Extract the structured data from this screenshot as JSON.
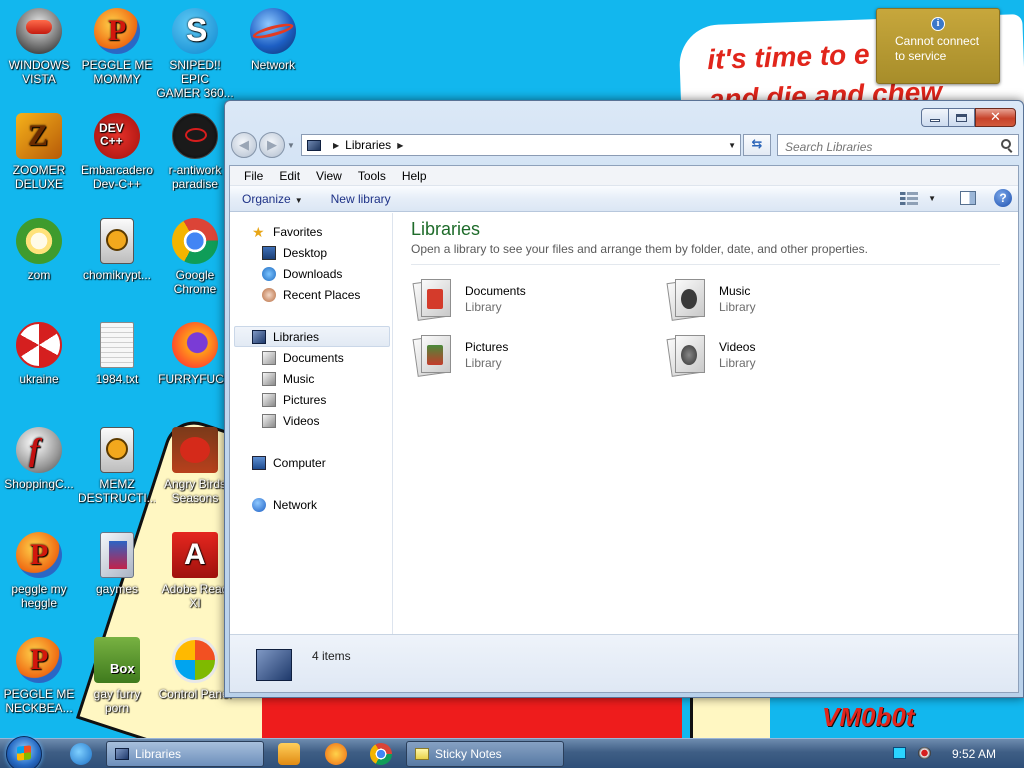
{
  "wallpaper": {
    "caption_line1": "it's time to e",
    "caption_line2": "and die and chew",
    "signature": "VM0b0t"
  },
  "desktop_icons": [
    {
      "label": "WINDOWS\nVISTA",
      "icon": "windows-vista-icon"
    },
    {
      "label": "PEGGLE ME\nMOMMY",
      "icon": "peggle-icon"
    },
    {
      "label": "SNIPED!! EPIC\nGAMER 360...",
      "icon": "skype-icon"
    },
    {
      "label": "Network",
      "icon": "network-globe-icon"
    },
    {
      "label": "ZOOMER\nDELUXE",
      "icon": "zuma-icon"
    },
    {
      "label": "Embarcadero\nDev-C++",
      "icon": "devcpp-icon"
    },
    {
      "label": "r-antiwork\nparadise",
      "icon": "r-antiwork-icon"
    },
    {
      "label": "zom",
      "icon": "plant-icon"
    },
    {
      "label": "chomikrypt...",
      "icon": "clock-doc-icon"
    },
    {
      "label": "Google\nChrome",
      "icon": "chrome-icon"
    },
    {
      "label": "ukraine",
      "icon": "radiation-icon"
    },
    {
      "label": "1984.txt",
      "icon": "text-file-icon"
    },
    {
      "label": "FURRYFUCK",
      "icon": "firefox-icon"
    },
    {
      "label": "ShoppingC...",
      "icon": "flash-icon"
    },
    {
      "label": "MEMZ\nDESTRUCTI...",
      "icon": "clock-doc-icon"
    },
    {
      "label": "Angry Birds\nSeasons",
      "icon": "angry-birds-icon"
    },
    {
      "label": "peggle my\nheggle",
      "icon": "peggle-icon"
    },
    {
      "label": "gaymes",
      "icon": "folder-icon"
    },
    {
      "label": "Adobe Read\nXI",
      "icon": "adobe-reader-icon"
    },
    {
      "label": "PEGGLE ME\nNECKBEA...",
      "icon": "peggle-icon"
    },
    {
      "label": "gay furry\nporn",
      "icon": "box-beaver-icon"
    },
    {
      "label": "Control Panel",
      "icon": "control-panel-icon"
    }
  ],
  "toast": {
    "message": "Cannot connect\nto service",
    "icon": "info-icon",
    "color": "#b8992f"
  },
  "window": {
    "address_segment": "Libraries",
    "search_placeholder": "Search Libraries",
    "menu": [
      "File",
      "Edit",
      "View",
      "Tools",
      "Help"
    ],
    "commands": {
      "organize": "Organize",
      "new_library": "New library"
    },
    "nav": {
      "favorites": "Favorites",
      "desktop": "Desktop",
      "downloads": "Downloads",
      "recent_places": "Recent Places",
      "libraries": "Libraries",
      "documents": "Documents",
      "music": "Music",
      "pictures": "Pictures",
      "videos": "Videos",
      "computer": "Computer",
      "network": "Network"
    },
    "main": {
      "title": "Libraries",
      "description": "Open a library to see your files and arrange them by folder, date, and other properties.",
      "items": [
        {
          "name": "Documents",
          "type": "Library",
          "icon": "documents-library-icon",
          "accent": "#d43b2b"
        },
        {
          "name": "Music",
          "type": "Library",
          "icon": "music-library-icon",
          "accent": "#3a3a3a"
        },
        {
          "name": "Pictures",
          "type": "Library",
          "icon": "pictures-library-icon",
          "accent": "#4a8a3a"
        },
        {
          "name": "Videos",
          "type": "Library",
          "icon": "videos-library-icon",
          "accent": "#555555"
        }
      ]
    },
    "details": {
      "count": "4 items"
    }
  },
  "taskbar": {
    "buttons": [
      {
        "label": "Libraries",
        "active": true
      },
      {
        "label": "Sticky Notes",
        "active": false
      }
    ],
    "clock": "9:52 AM"
  },
  "colors": {
    "desktop": "#12b7ee",
    "title_green": "#1e6b2a",
    "command_blue": "#1e3287"
  }
}
